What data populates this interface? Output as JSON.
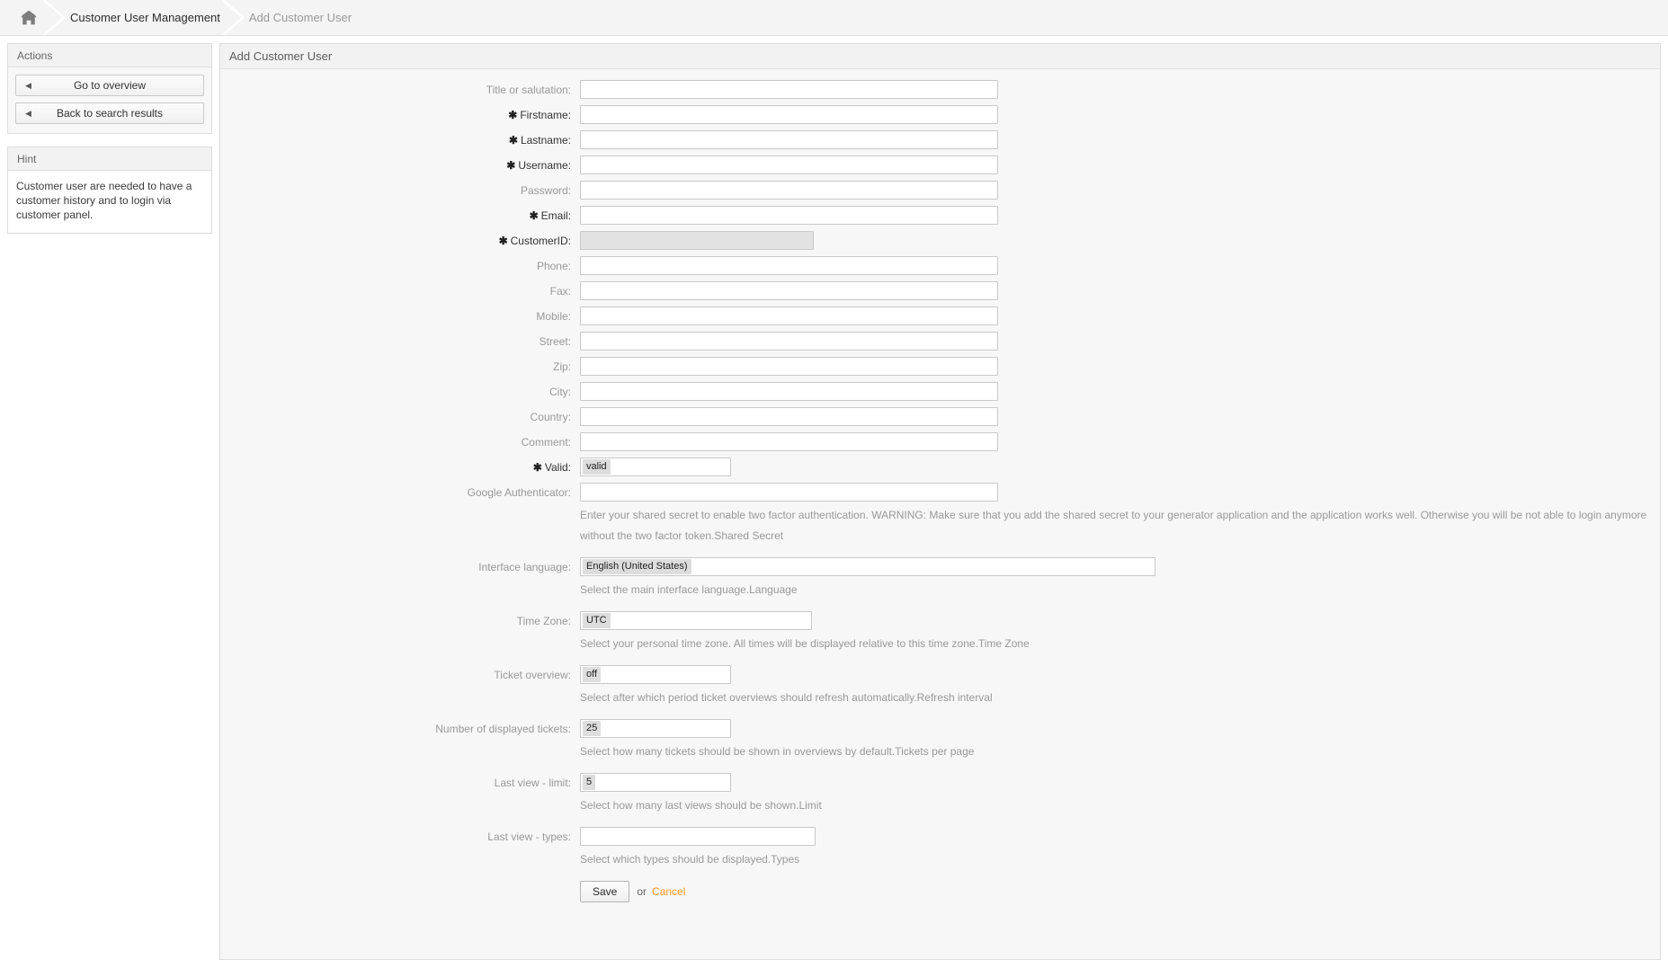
{
  "breadcrumb": {
    "home_icon": "home-icon",
    "items": [
      {
        "label": "Customer User Management",
        "state": "active"
      },
      {
        "label": "Add Customer User",
        "state": "muted"
      }
    ]
  },
  "sidebar": {
    "actions": {
      "title": "Actions",
      "buttons": [
        {
          "label": "Go to overview",
          "arrow": "◀"
        },
        {
          "label": "Back to search results",
          "arrow": "◀"
        }
      ]
    },
    "hint": {
      "title": "Hint",
      "text": "Customer user are needed to have a customer history and to login via customer panel."
    }
  },
  "main": {
    "title": "Add Customer User",
    "fields": {
      "title_salutation": {
        "label": "Title or salutation:",
        "required": false,
        "value": "",
        "type": "text"
      },
      "firstname": {
        "label": "Firstname:",
        "required": true,
        "value": "",
        "type": "text"
      },
      "lastname": {
        "label": "Lastname:",
        "required": true,
        "value": "",
        "type": "text"
      },
      "username": {
        "label": "Username:",
        "required": true,
        "value": "",
        "type": "text"
      },
      "password": {
        "label": "Password:",
        "required": false,
        "value": "",
        "type": "text"
      },
      "email": {
        "label": "Email:",
        "required": true,
        "value": "",
        "type": "text"
      },
      "customer_id": {
        "label": "CustomerID:",
        "required": true,
        "value": "",
        "type": "select-disabled"
      },
      "phone": {
        "label": "Phone:",
        "required": false,
        "value": "",
        "type": "text"
      },
      "fax": {
        "label": "Fax:",
        "required": false,
        "value": "",
        "type": "text"
      },
      "mobile": {
        "label": "Mobile:",
        "required": false,
        "value": "",
        "type": "text"
      },
      "street": {
        "label": "Street:",
        "required": false,
        "value": "",
        "type": "text"
      },
      "zip": {
        "label": "Zip:",
        "required": false,
        "value": "",
        "type": "text"
      },
      "city": {
        "label": "City:",
        "required": false,
        "value": "",
        "type": "text"
      },
      "country": {
        "label": "Country:",
        "required": false,
        "value": "",
        "type": "text"
      },
      "comment": {
        "label": "Comment:",
        "required": false,
        "value": "",
        "type": "text"
      },
      "valid": {
        "label": "Valid:",
        "required": true,
        "value": "valid",
        "type": "select"
      },
      "google_authenticator": {
        "label": "Google Authenticator:",
        "required": false,
        "value": "",
        "type": "text",
        "help": "Enter your shared secret to enable two factor authentication. WARNING: Make sure that you add the shared secret to your generator application and the application works well. Otherwise you will be not able to login anymore without the two factor token.Shared Secret"
      },
      "interface_language": {
        "label": "Interface language:",
        "required": false,
        "value": "English (United States)",
        "type": "select",
        "help": "Select the main interface language.Language"
      },
      "time_zone": {
        "label": "Time Zone:",
        "required": false,
        "value": "UTC",
        "type": "select",
        "help": "Select your personal time zone. All times will be displayed relative to this time zone.Time Zone"
      },
      "ticket_overview": {
        "label": "Ticket overview:",
        "required": false,
        "value": "off",
        "type": "select",
        "help": "Select after which period ticket overviews should refresh automatically.Refresh interval"
      },
      "displayed_tickets": {
        "label": "Number of displayed tickets:",
        "required": false,
        "value": "25",
        "type": "select",
        "help": "Select how many tickets should be shown in overviews by default.Tickets per page"
      },
      "last_view_limit": {
        "label": "Last view - limit:",
        "required": false,
        "value": "5",
        "type": "select",
        "help": "Select how many last views should be shown.Limit"
      },
      "last_view_types": {
        "label": "Last view - types:",
        "required": false,
        "value": "",
        "type": "select",
        "help": "Select which types should be displayed.Types"
      }
    },
    "submit": {
      "save_label": "Save",
      "or_label": "or",
      "cancel_label": "Cancel",
      "cancel_color": "#ff9922"
    }
  }
}
